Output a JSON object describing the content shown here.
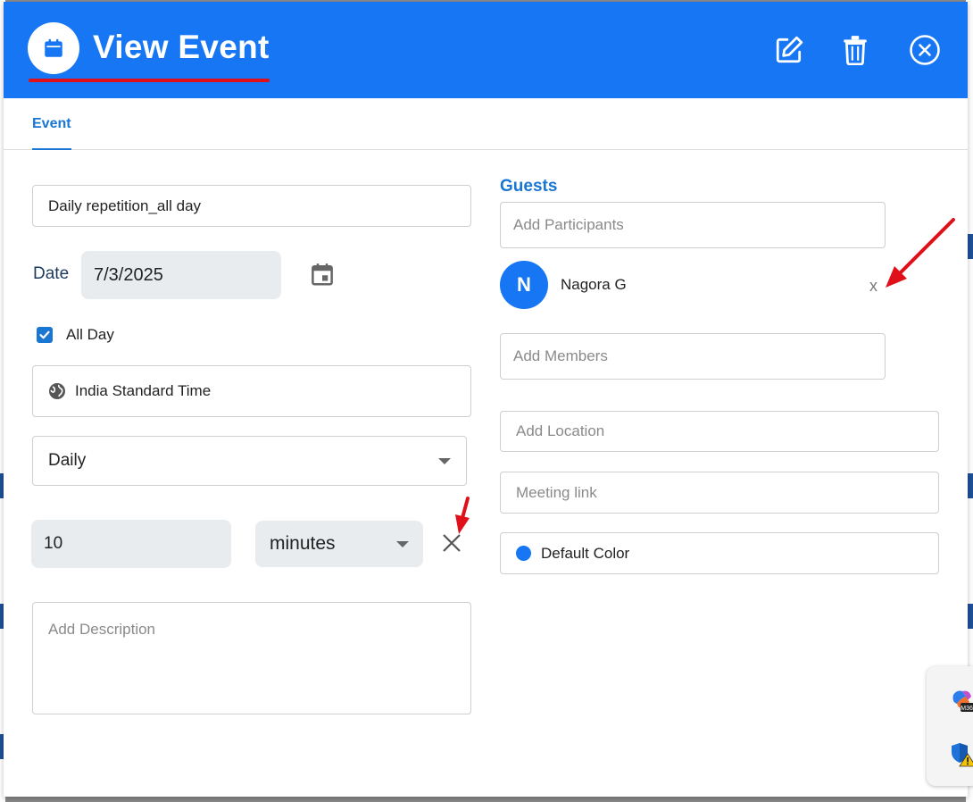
{
  "header": {
    "title": "View Event",
    "icon": "calendar-icon",
    "actions": [
      "edit-icon",
      "trash-icon",
      "close-circle-icon"
    ]
  },
  "tabs": [
    {
      "label": "Event",
      "active": true
    }
  ],
  "form": {
    "title_value": "Daily repetition_all day",
    "date_label": "Date",
    "date_value": "7/3/2025",
    "all_day_label": "All Day",
    "all_day_checked": true,
    "timezone_value": "India Standard Time",
    "repeat_value": "Daily",
    "reminder_value": "10",
    "reminder_unit": "minutes",
    "description_placeholder": "Add Description"
  },
  "guests": {
    "title": "Guests",
    "participants_placeholder": "Add Participants",
    "list": [
      {
        "initial": "N",
        "name": "Nagora G",
        "remove_label": "x"
      }
    ],
    "members_placeholder": "Add Members"
  },
  "location_placeholder": "Add Location",
  "meeting_link_placeholder": "Meeting link",
  "color": {
    "label": "Default Color",
    "value": "#1776f3"
  },
  "colors": {
    "header": "#1776f3",
    "accent": "#1976d2",
    "annotation": "#e0101a"
  }
}
